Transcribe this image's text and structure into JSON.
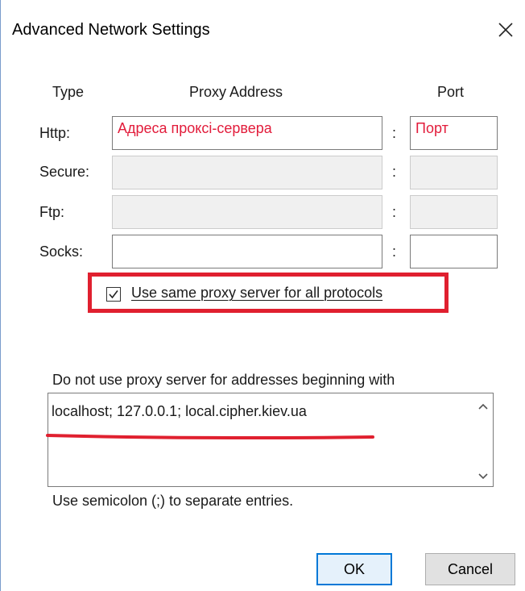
{
  "window": {
    "title": "Advanced Network Settings",
    "close_icon": "close-icon"
  },
  "headers": {
    "type": "Type",
    "proxy_address": "Proxy Address",
    "port": "Port"
  },
  "rows": [
    {
      "label": "Http:",
      "address_value": "Адреса проксі-сервера",
      "port_value": "Порт",
      "enabled": true
    },
    {
      "label": "Secure:",
      "address_value": "",
      "port_value": "",
      "enabled": false
    },
    {
      "label": "Ftp:",
      "address_value": "",
      "port_value": "",
      "enabled": false
    },
    {
      "label": "Socks:",
      "address_value": "",
      "port_value": "",
      "enabled": true
    }
  ],
  "separator": ":",
  "same_proxy": {
    "label": "Use same proxy server for all protocols",
    "checked": true
  },
  "exceptions": {
    "label": "Do not use proxy server for addresses beginning with",
    "value": "localhost; 127.0.0.1; local.cipher.kiev.ua",
    "hint": "Use semicolon (;) to separate entries."
  },
  "buttons": {
    "ok": "OK",
    "cancel": "Cancel"
  },
  "colors": {
    "annotation_red": "#e0202f",
    "field_text_red": "#e21c3b",
    "accent_blue": "#0078d7"
  }
}
